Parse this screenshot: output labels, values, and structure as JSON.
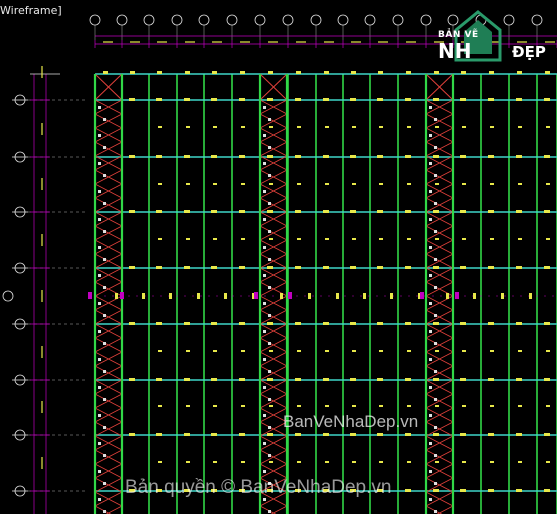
{
  "viewport": {
    "view_label": "Wireframe]",
    "background": "#000000"
  },
  "logo": {
    "line1": "BẢN VẼ",
    "line2": "NH",
    "line3": "ĐẸP",
    "accent": "#2a9a6a"
  },
  "watermarks": {
    "center": "BanVeNhaDep.vn",
    "bottom": "Bản quyền © BanVeNhaDep.vn"
  },
  "colors": {
    "grid_line": "#31d847",
    "beam_line": "#3fd6c8",
    "bracing": "#e0403a",
    "column_marker": "#e8e84a",
    "dimension": "#c000c0",
    "bubble": "#e0e0e0"
  },
  "icons": {
    "axis_bubble": "circle-axis-marker",
    "house": "house-icon"
  }
}
